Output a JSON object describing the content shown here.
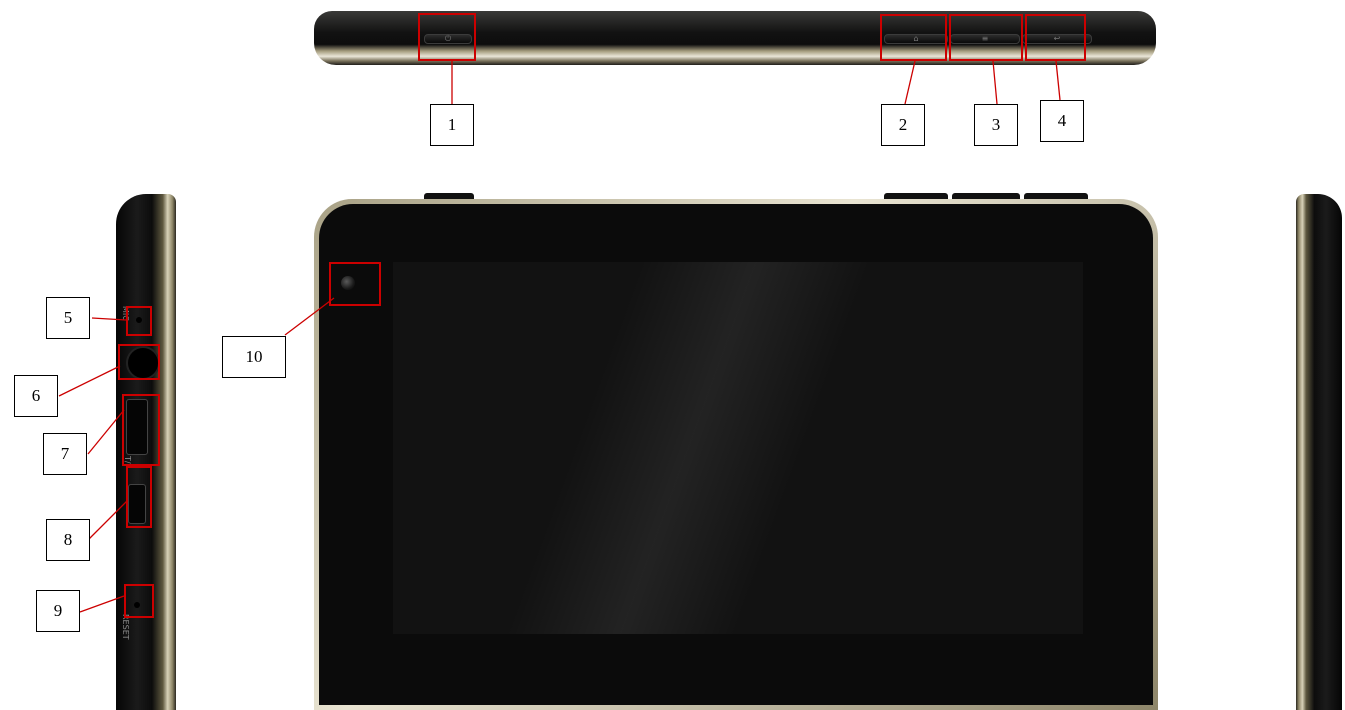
{
  "labels": [
    "1",
    "2",
    "3",
    "4",
    "5",
    "6",
    "7",
    "8",
    "9",
    "10"
  ],
  "colors": {
    "highlight": "#cc0000",
    "bezel": "#0b0b0b",
    "trim": "#d8d2b8"
  },
  "icons": {
    "power": "power-icon",
    "home": "home-icon",
    "menu": "menu-icon",
    "back": "back-icon",
    "camera": "camera-icon"
  },
  "side_text": {
    "mic": "MIC",
    "tf": "T/F",
    "reset": "RESET"
  }
}
